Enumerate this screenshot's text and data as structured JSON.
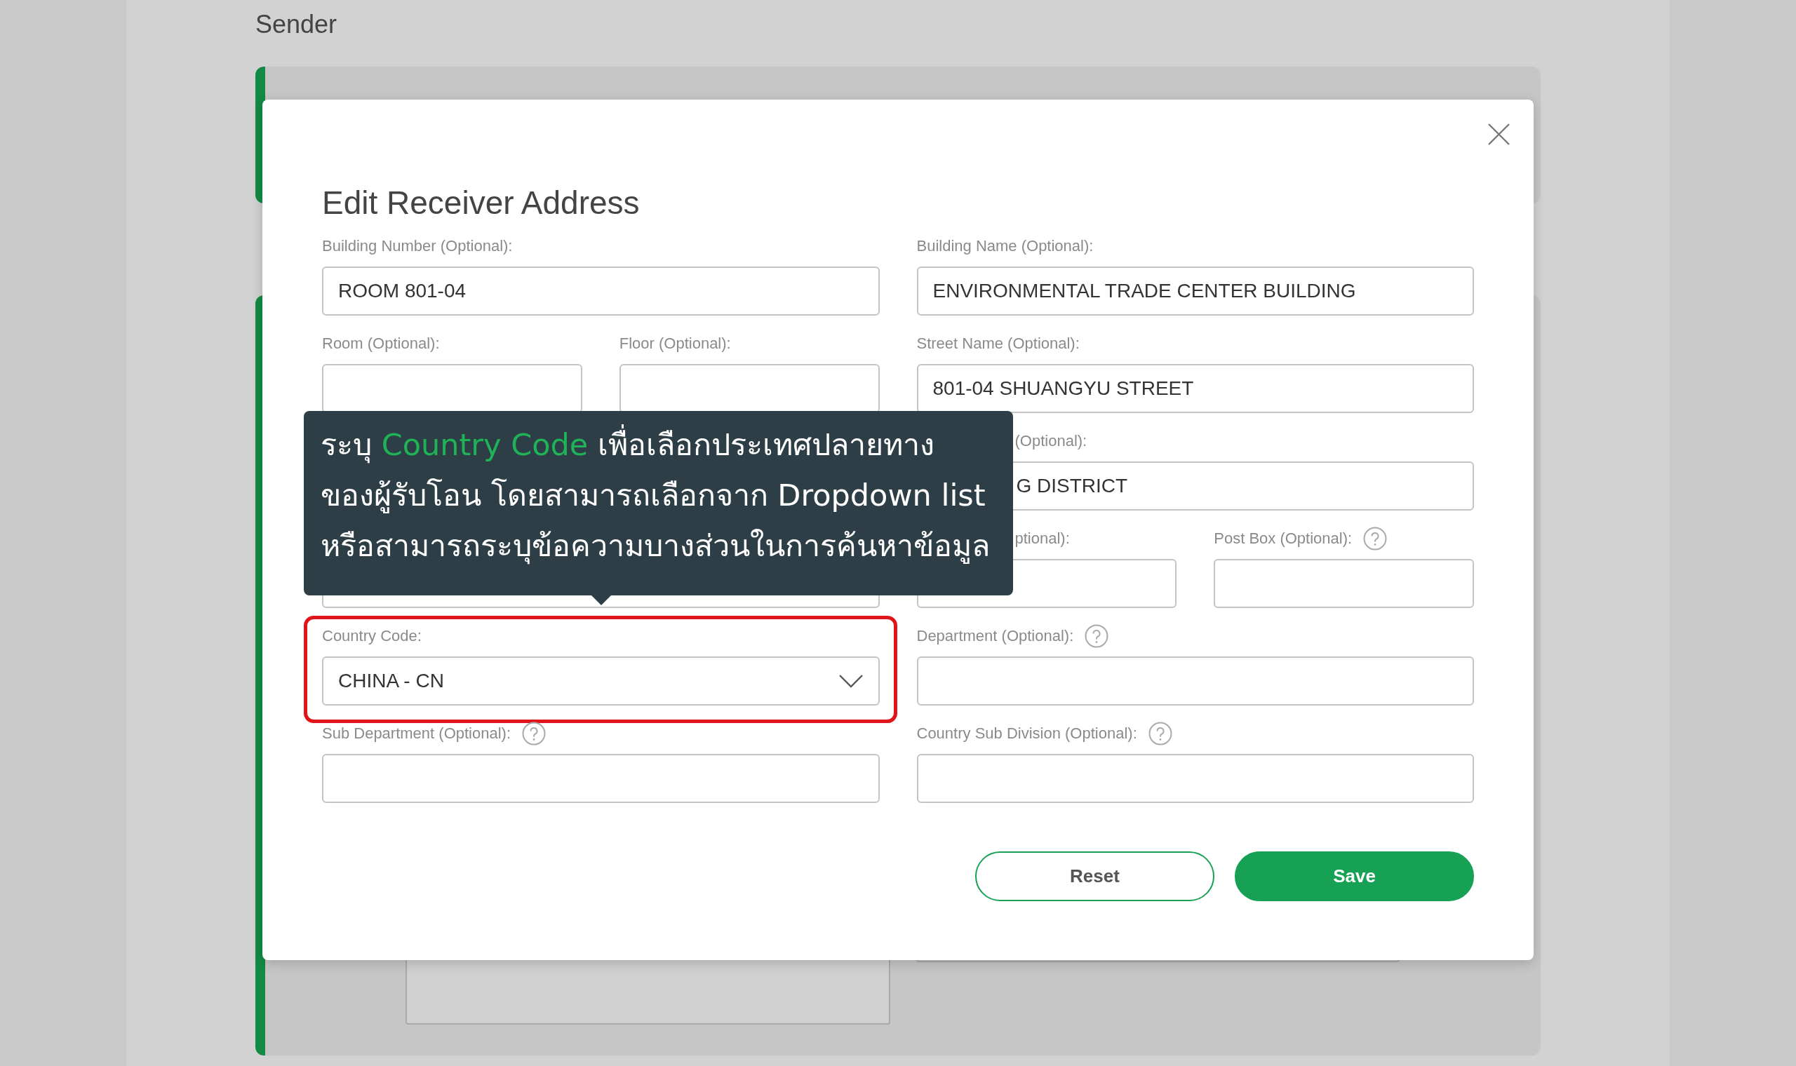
{
  "page": {
    "heading": "Sender"
  },
  "dialog": {
    "title": "Edit Receiver Address",
    "rows": [
      {
        "fields": [
          {
            "kind": "wide",
            "label": "Building Number (Optional):",
            "value": "ROOM 801-04"
          },
          {
            "kind": "wide",
            "label": "Building Name (Optional):",
            "value": "ENVIRONMENTAL TRADE CENTER BUILDING"
          }
        ]
      },
      {
        "fields": [
          {
            "kind": "narrow",
            "label": "Room (Optional):"
          },
          {
            "kind": "narrow",
            "label": "Floor (Optional):"
          },
          {
            "kind": "wide",
            "label": "Street Name (Optional):",
            "value": "801-04 SHUANGYU STREET"
          }
        ]
      },
      {
        "fields": [
          {
            "kind": "wide",
            "label": "(Optional):",
            "value": "G DISTRICT",
            "covered": true
          }
        ]
      },
      {
        "fields": [
          {
            "kind": "wide"
          },
          {
            "kind": "narrow",
            "label": "ptional):",
            "covered": true
          },
          {
            "kind": "narrow",
            "label": "Post Box (Optional):",
            "help": true
          }
        ]
      },
      {
        "fields": [
          {
            "kind": "select",
            "label": "Country Code:",
            "value": "CHINA - CN",
            "highlighted": true
          },
          {
            "kind": "wide",
            "label": "Department (Optional):",
            "help": true
          }
        ]
      },
      {
        "fields": [
          {
            "kind": "wide",
            "label": "Sub Department (Optional):",
            "help": true
          },
          {
            "kind": "wide",
            "label": "Country Sub Division (Optional):",
            "help": true
          }
        ]
      }
    ],
    "buttons": [
      {
        "label": "Reset",
        "kind": "secondary"
      },
      {
        "label": "Save",
        "kind": "primary"
      }
    ]
  },
  "tooltip": {
    "lines": [
      [
        {
          "text": "ระบุ ",
          "highlight": false
        },
        {
          "text": "Country Code",
          "highlight": true
        },
        {
          "text": " เพื่อเลือกประเทศปลายทาง",
          "highlight": false
        }
      ],
      [
        {
          "text": "ของผู้รับโอน โดยสามารถเลือกจาก Dropdown list",
          "highlight": false
        }
      ],
      [
        {
          "text": "หรือสามารถระบุข้อความบางส่วนในการค้นหาข้อมูล",
          "highlight": false
        }
      ]
    ]
  }
}
